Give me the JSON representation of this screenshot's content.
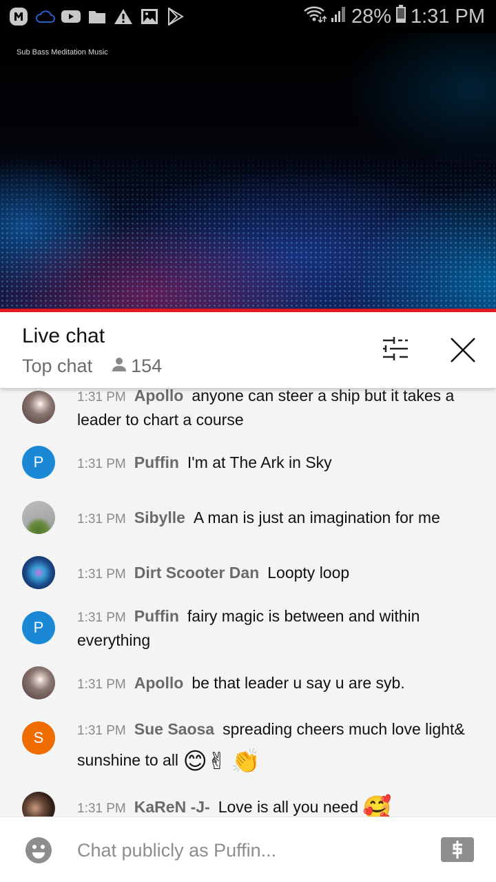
{
  "status_bar": {
    "notification_icons": [
      "app-m-icon",
      "cloud-icon",
      "youtube-icon",
      "folder-icon",
      "warning-icon",
      "gallery-icon",
      "play-store-icon"
    ],
    "battery_percent": "28%",
    "time": "1:31 PM"
  },
  "video": {
    "channel_watermark": "Sub Bass Meditation Music"
  },
  "chat_header": {
    "title": "Live chat",
    "mode": "Top chat",
    "viewer_count": "154"
  },
  "messages": [
    {
      "avatar_type": "image",
      "avatar_desc": "Apollo profile photo",
      "time": "1:31 PM",
      "author": "Apollo",
      "text": "anyone can steer a ship but it takes a leader to chart a course",
      "emojis": []
    },
    {
      "avatar_type": "letter",
      "avatar_letter": "P",
      "avatar_color": "#1a88d4",
      "time": "1:31 PM",
      "author": "Puffin",
      "text": "I'm at The Ark in Sky",
      "emojis": []
    },
    {
      "avatar_type": "image",
      "avatar_desc": "Sibylle profile photo",
      "time": "1:31 PM",
      "author": "Sibylle",
      "text": "A man is just an imagination for me",
      "emojis": []
    },
    {
      "avatar_type": "image",
      "avatar_desc": "Dirt Scooter Dan profile photo",
      "time": "1:31 PM",
      "author": "Dirt Scooter Dan",
      "text": "Loopty loop",
      "emojis": []
    },
    {
      "avatar_type": "letter",
      "avatar_letter": "P",
      "avatar_color": "#1a88d4",
      "time": "1:31 PM",
      "author": "Puffin",
      "text": "fairy magic is between and within everything",
      "emojis": []
    },
    {
      "avatar_type": "image",
      "avatar_desc": "Apollo profile photo",
      "time": "1:31 PM",
      "author": "Apollo",
      "text": "be that leader u say u are syb.",
      "emojis": []
    },
    {
      "avatar_type": "letter",
      "avatar_letter": "S",
      "avatar_color": "#ef6c00",
      "time": "1:31 PM",
      "author": "Sue Saosa",
      "text": "spreading cheers much love light& sunshine to all",
      "emojis": [
        "😊✌",
        "👏"
      ]
    },
    {
      "avatar_type": "image",
      "avatar_desc": "KaReN -J- profile photo",
      "time": "1:31 PM",
      "author": "KaReN -J-",
      "text": "Love is all you need",
      "emojis": [
        "🥰"
      ]
    }
  ],
  "input": {
    "placeholder": "Chat publicly as Puffin...",
    "value": ""
  },
  "colors": {
    "progress_bar": "#e21a1a",
    "author_name": "#6a6a6a",
    "timestamp": "#8a8a8a"
  }
}
